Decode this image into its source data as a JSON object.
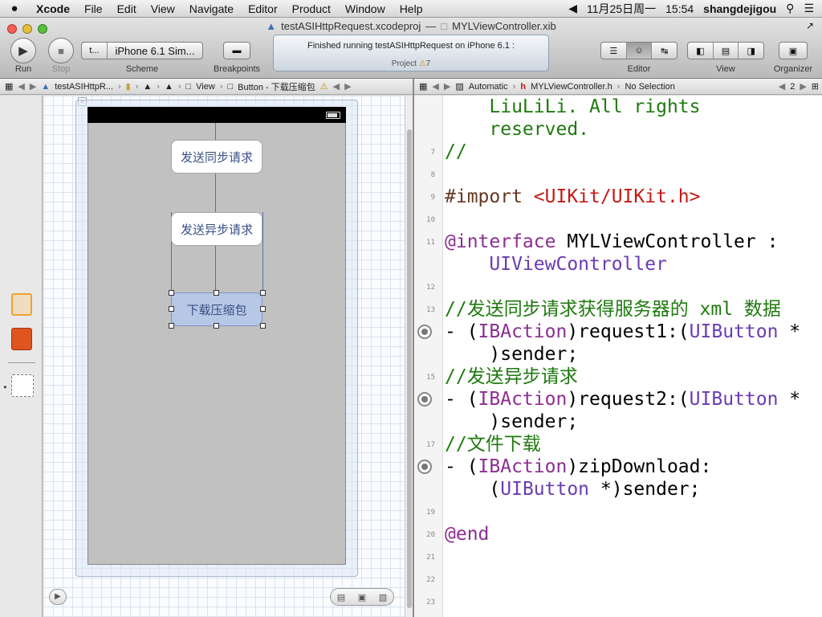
{
  "menubar": {
    "apple": "",
    "app": "Xcode",
    "items": [
      "File",
      "Edit",
      "View",
      "Navigate",
      "Editor",
      "Product",
      "Window",
      "Help"
    ],
    "date": "11月25日周一",
    "time": "15:54",
    "user": "shangdejigou"
  },
  "window": {
    "title": "testASIHttpRequest.xcodeproj",
    "sep": "—",
    "file": "MYLViewController.xib"
  },
  "toolbar": {
    "run": "Run",
    "stop": "Stop",
    "scheme_left": "t...",
    "scheme_right": "iPhone 6.1 Sim...",
    "scheme": "Scheme",
    "breakpoints": "Breakpoints",
    "activity": "Finished running testASIHttpRequest on iPhone 6.1 :",
    "project": "Project",
    "warnings": "7",
    "editor": "Editor",
    "view": "View",
    "organizer": "Organizer"
  },
  "jumpbar_left": {
    "items": [
      "testASIHttpR...",
      "View",
      "Button - 下载压缩包"
    ]
  },
  "jumpbar_right": {
    "items": [
      "Automatic",
      "MYLViewController.h",
      "No Selection"
    ],
    "count": "2"
  },
  "ib": {
    "btn1": "发送同步请求",
    "btn2": "发送异步请求",
    "btn3": "下载压缩包"
  },
  "code": {
    "lines": [
      {
        "n": "",
        "t": "    LiuLiLi. All rights"
      },
      {
        "n": "",
        "t": "    reserved."
      },
      {
        "n": "7",
        "t": "//"
      },
      {
        "n": "8",
        "t": ""
      },
      {
        "n": "9",
        "t": "#import <UIKit/UIKit.h>"
      },
      {
        "n": "10",
        "t": ""
      },
      {
        "n": "11",
        "t": "@interface MYLViewController :"
      },
      {
        "n": "",
        "t": "    UIViewController"
      },
      {
        "n": "12",
        "t": ""
      },
      {
        "n": "13",
        "t": "//发送同步请求获得服务器的 xml 数据"
      },
      {
        "n": "",
        "t": "- (IBAction)request1:(UIButton *"
      },
      {
        "n": "",
        "t": "    )sender;"
      },
      {
        "n": "15",
        "t": "//发送异步请求"
      },
      {
        "n": "",
        "t": "- (IBAction)request2:(UIButton *"
      },
      {
        "n": "",
        "t": "    )sender;"
      },
      {
        "n": "17",
        "t": "//文件下载"
      },
      {
        "n": "",
        "t": "- (IBAction)zipDownload:"
      },
      {
        "n": "",
        "t": "    (UIButton *)sender;"
      },
      {
        "n": "19",
        "t": ""
      },
      {
        "n": "20",
        "t": "@end"
      },
      {
        "n": "21",
        "t": ""
      },
      {
        "n": "22",
        "t": ""
      },
      {
        "n": "23",
        "t": ""
      }
    ]
  },
  "colors": {
    "comment": "#1f7a0f",
    "keyword": "#8b2e91",
    "string": "#c41a16",
    "type": "#6a3bb2",
    "selection": "#b7c7e6"
  }
}
